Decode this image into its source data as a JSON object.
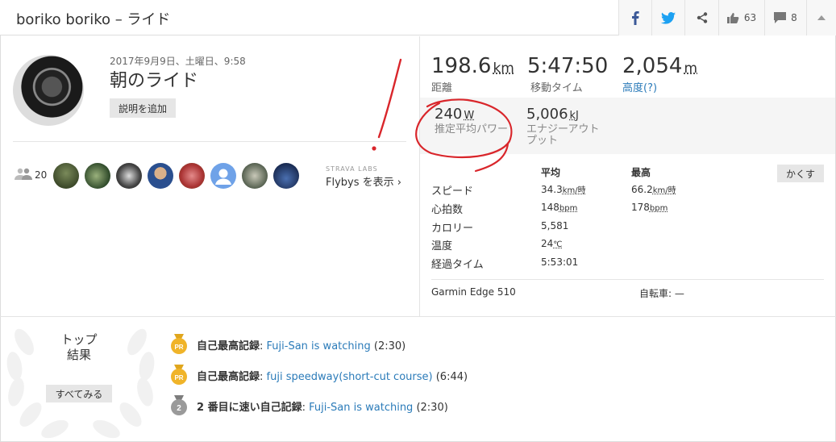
{
  "header": {
    "title": "boriko boriko – ライド",
    "kudos_count": "63",
    "comment_count": "8"
  },
  "activity": {
    "date": "2017年9月9日、土曜日、9:58",
    "name": "朝のライド",
    "add_description": "説明を追加"
  },
  "athletes": {
    "count": "20",
    "labs": "STRAVA LABS",
    "flybys": "Flybys を表示 ›"
  },
  "stats": {
    "distance": {
      "value": "198.6",
      "unit": "km",
      "label": "距離"
    },
    "moving_time": {
      "value": "5:47:50",
      "label": "移動タイム"
    },
    "elevation": {
      "value": "2,054",
      "unit": "m",
      "label": "高度(?)"
    },
    "power": {
      "value": "240",
      "unit": "W",
      "label": "推定平均パワー"
    },
    "energy": {
      "value": "5,006",
      "unit": "kJ",
      "label_line1": "エナジーアウト",
      "label_line2": "プット"
    }
  },
  "table": {
    "avg_header": "平均",
    "max_header": "最高",
    "hide_button": "かくす",
    "rows": [
      {
        "label": "スピード",
        "avg": "34.3",
        "avg_unit": "km/時",
        "max": "66.2",
        "max_unit": "km/時"
      },
      {
        "label": "心拍数",
        "avg": "148",
        "avg_unit": "bpm",
        "max": "178",
        "max_unit": "bpm"
      },
      {
        "label": "カロリー",
        "avg": "5,581",
        "avg_unit": "",
        "max": "",
        "max_unit": ""
      },
      {
        "label": "温度",
        "avg": "24",
        "avg_unit": "℃",
        "max": "",
        "max_unit": ""
      },
      {
        "label": "経過タイム",
        "avg": "5:53:01",
        "avg_unit": "",
        "max": "",
        "max_unit": ""
      }
    ]
  },
  "device": "Garmin Edge 510",
  "bike": "自転車: —",
  "top_results": {
    "title_line1": "トップ",
    "title_line2": "結果",
    "see_all": "すべてみる",
    "achievements": [
      {
        "kind": "自己最高記録",
        "segment": "Fuji-San is watching",
        "time": "(2:30)",
        "medal": "PR"
      },
      {
        "kind": "自己最高記録",
        "segment": "fuji speedway(short-cut course)",
        "time": "(6:44)",
        "medal": "PR"
      },
      {
        "kind": "2 番目に速い自己記録",
        "segment": "Fuji-San is watching",
        "time": "(2:30)",
        "medal": "2"
      }
    ]
  },
  "colors": {
    "link": "#2b7bb9",
    "annotation": "#d9262b",
    "medal_gold": "#f0b429",
    "medal_silver": "#9a9a9a"
  }
}
